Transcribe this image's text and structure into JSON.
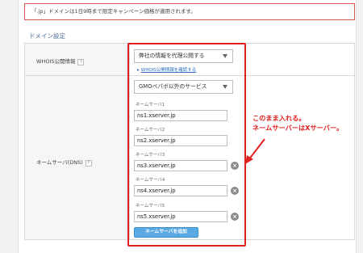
{
  "notice": {
    "text": "「.jp」ドメインは1日9時まで限定キャンペーン価格が適用されます。"
  },
  "section_title": "ドメイン設定",
  "whois": {
    "label": "WHOIS公開情報",
    "help": "?",
    "select_value": "弊社の情報を代理公開する",
    "link": "WHOIS公開情報を確認する"
  },
  "dns": {
    "label": "ネームサーバ(DNS)",
    "help": "?",
    "select_value": "GMOペパボ以外のサービス",
    "servers": [
      {
        "label": "ネームサーバ1",
        "value": "ns1.xserver.jp",
        "deletable": false
      },
      {
        "label": "ネームサーバ2",
        "value": "ns2.xserver.jp",
        "deletable": false
      },
      {
        "label": "ネームサーバ3",
        "value": "ns3.xserver.jp",
        "deletable": true
      },
      {
        "label": "ネームサーバ4",
        "value": "ns4.xserver.jp",
        "deletable": true
      },
      {
        "label": "ネームサーバ5",
        "value": "ns5.xserver.jp",
        "deletable": true
      }
    ],
    "add_button": "ネームサーバを追加"
  },
  "annotation": {
    "line1": "このまま入れる。",
    "line2": "ネームサーバーはXサーバー。",
    "color": "#e0201e"
  },
  "icons": {
    "delete": "×",
    "help": "?"
  }
}
